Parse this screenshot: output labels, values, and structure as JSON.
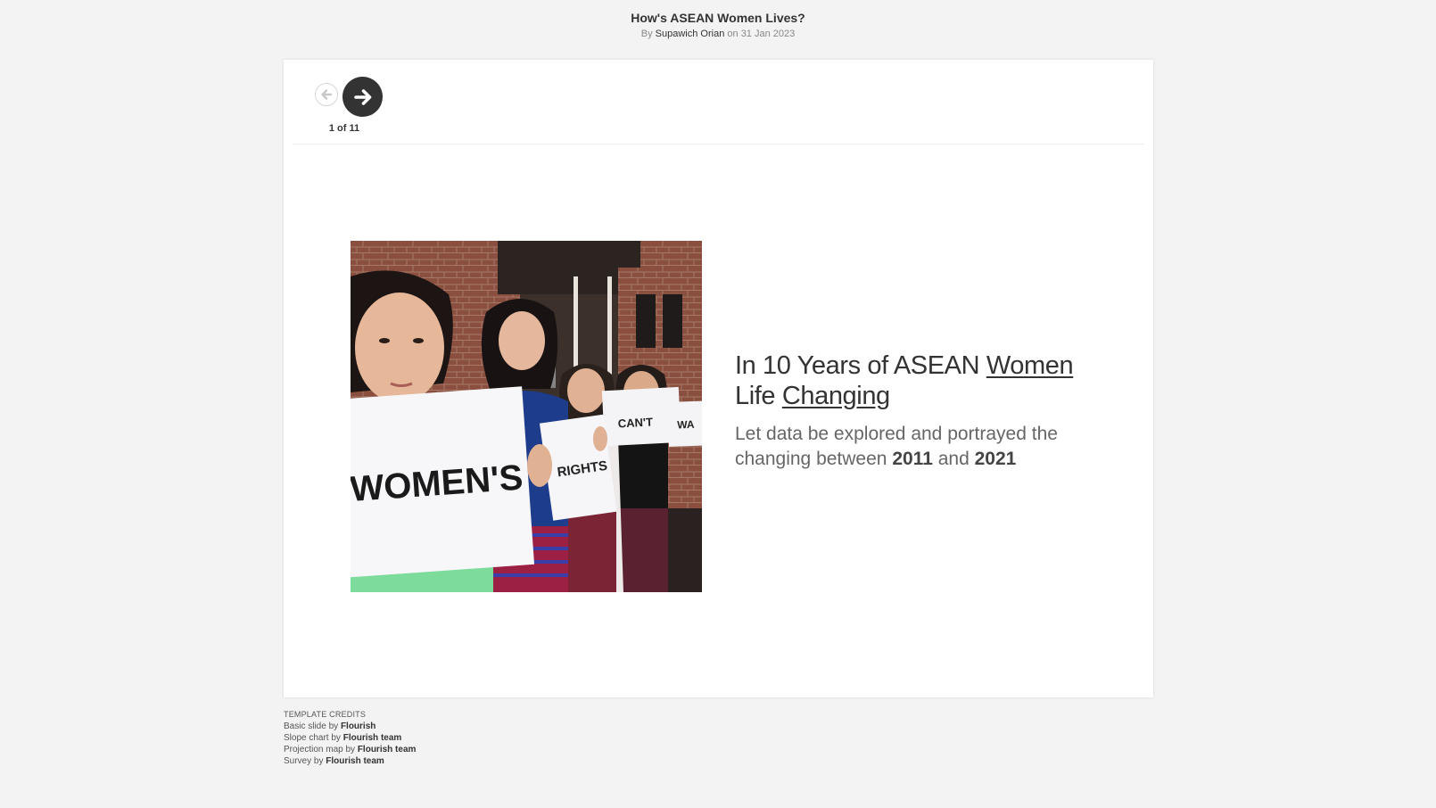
{
  "header": {
    "title": "How's ASEAN Women Lives?",
    "by": "By",
    "author": "Supawich Orian",
    "on": "on",
    "date": "31 Jan 2023"
  },
  "nav": {
    "counter": "1 of 11",
    "current": 1,
    "total": 11
  },
  "slide": {
    "photo": {
      "sign_words": [
        "WOMEN'S",
        "RIGHTS",
        "CAN'T",
        "WA"
      ]
    },
    "heading": {
      "part1": "In 10 Years of ASEAN ",
      "link1": "Women",
      "part2": " Life ",
      "link2": "Changing"
    },
    "subtitle": {
      "part1": "Let data be explored and portrayed the changing between ",
      "year1": "2011",
      "part2": " and ",
      "year2": "2021"
    }
  },
  "credits": {
    "title": "TEMPLATE CREDITS",
    "items": [
      {
        "name": "Basic slide",
        "by": "by",
        "author": "Flourish"
      },
      {
        "name": "Slope chart",
        "by": "by",
        "author": "Flourish team"
      },
      {
        "name": "Projection map",
        "by": "by",
        "author": "Flourish team"
      },
      {
        "name": "Survey",
        "by": "by",
        "author": "Flourish team"
      }
    ]
  },
  "colors": {
    "background": "#f3f3f3",
    "card": "#ffffff",
    "button_dark": "#333333",
    "text": "#333333",
    "muted": "#888888"
  },
  "icons": {
    "prev": "arrow-left-icon",
    "next": "arrow-right-icon"
  }
}
